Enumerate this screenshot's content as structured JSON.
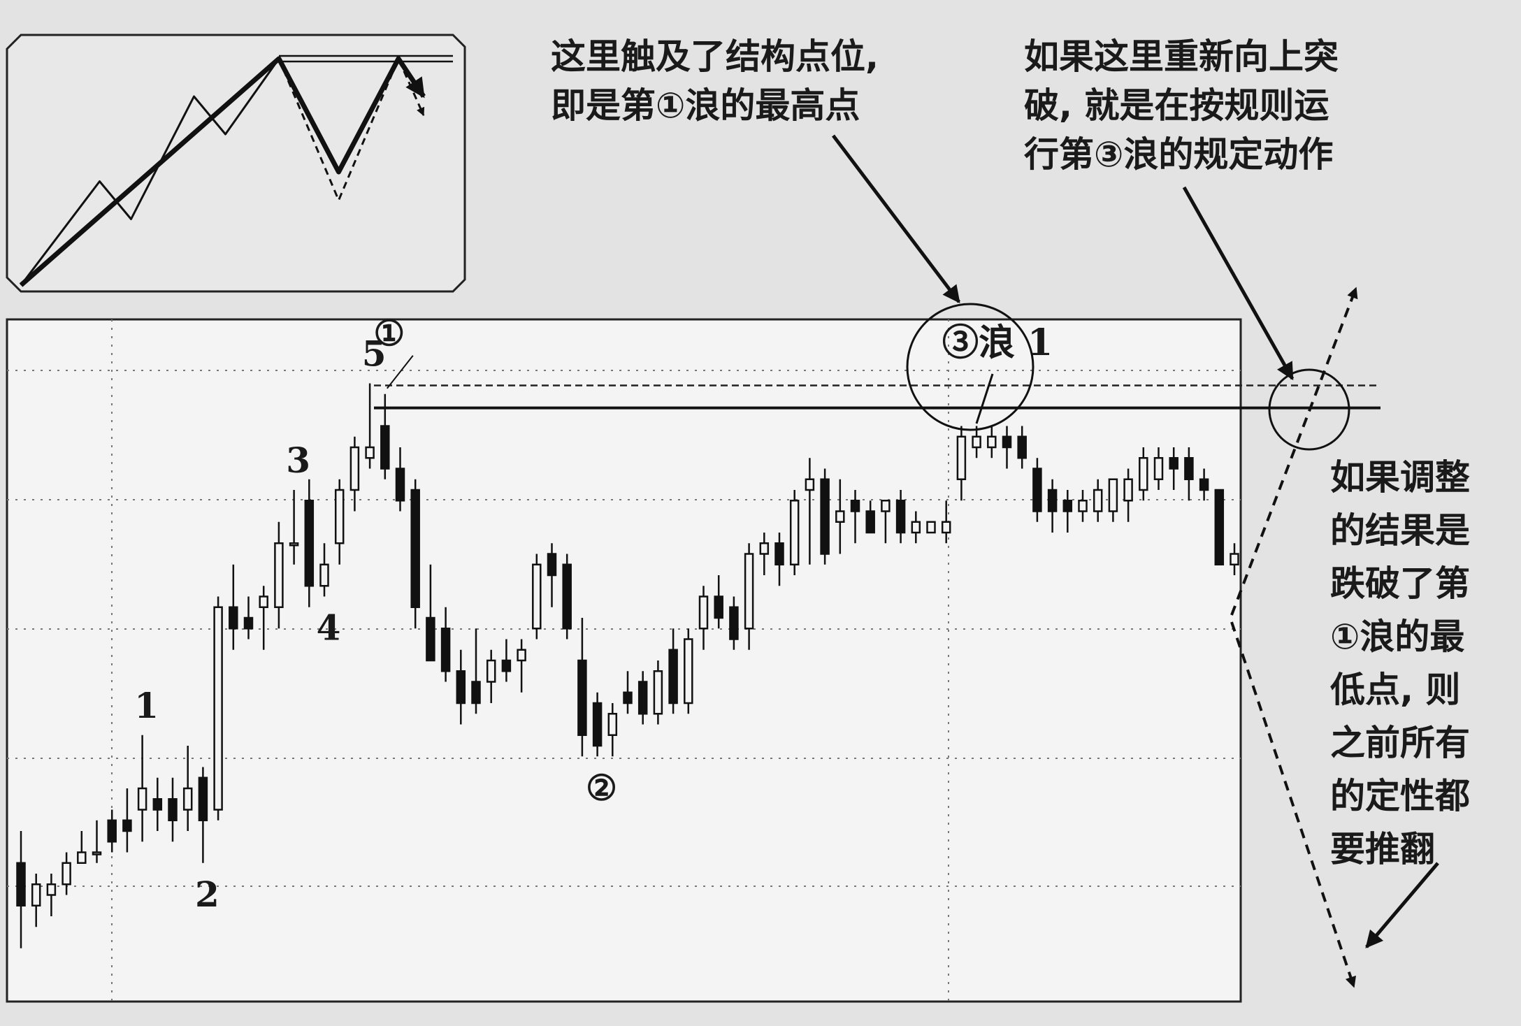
{
  "annotations": {
    "top_left": [
      "这里触及了结构点位,",
      "即是第①浪的最高点"
    ],
    "top_right": [
      "如果这里重新向上突",
      "破, 就是在按规则运",
      "行第③浪的规定动作"
    ],
    "right_side": [
      "如果调整",
      "的结果是",
      "跌破了第",
      "①浪的最",
      "低点, 则",
      "之前所有",
      "的定性都",
      "要推翻"
    ]
  },
  "chart_data": {
    "type": "candlestick",
    "title": "",
    "xlabel": "",
    "ylabel": "",
    "grid": true,
    "wave_labels": [
      {
        "text": "1",
        "bar": 8
      },
      {
        "text": "2",
        "bar": 12
      },
      {
        "text": "3",
        "bar": 18
      },
      {
        "text": "4",
        "bar": 20
      },
      {
        "text": "5",
        "bar": 23
      },
      {
        "text": "①",
        "bar": 24
      },
      {
        "text": "②",
        "bar": 38
      },
      {
        "text": "③浪 1",
        "bar": 63
      }
    ],
    "levels": [
      {
        "name": "wave1-high",
        "style": "dashed",
        "value": 104.8
      },
      {
        "name": "structure-line",
        "style": "solid",
        "value": 102.7
      }
    ],
    "candles": [
      {
        "o": 60,
        "h": 63,
        "l": 52,
        "c": 56
      },
      {
        "o": 56,
        "h": 59,
        "l": 54,
        "c": 58
      },
      {
        "o": 57,
        "h": 59,
        "l": 55,
        "c": 58
      },
      {
        "o": 58,
        "h": 61,
        "l": 57,
        "c": 60
      },
      {
        "o": 60,
        "h": 63,
        "l": 60,
        "c": 61
      },
      {
        "o": 61,
        "h": 64,
        "l": 60,
        "c": 61
      },
      {
        "o": 64,
        "h": 65,
        "l": 61,
        "c": 62
      },
      {
        "o": 64,
        "h": 67,
        "l": 61,
        "c": 63
      },
      {
        "o": 65,
        "h": 72,
        "l": 62,
        "c": 67
      },
      {
        "o": 66,
        "h": 68,
        "l": 63,
        "c": 65
      },
      {
        "o": 66,
        "h": 68,
        "l": 62,
        "c": 64
      },
      {
        "o": 65,
        "h": 71,
        "l": 63,
        "c": 67
      },
      {
        "o": 68,
        "h": 69,
        "l": 60,
        "c": 64
      },
      {
        "o": 65,
        "h": 85,
        "l": 64,
        "c": 84
      },
      {
        "o": 84,
        "h": 88,
        "l": 80,
        "c": 82
      },
      {
        "o": 83,
        "h": 85,
        "l": 81,
        "c": 82
      },
      {
        "o": 84,
        "h": 86,
        "l": 80,
        "c": 85
      },
      {
        "o": 84,
        "h": 92,
        "l": 82,
        "c": 90
      },
      {
        "o": 90,
        "h": 95,
        "l": 88,
        "c": 90
      },
      {
        "o": 94,
        "h": 96,
        "l": 84,
        "c": 86
      },
      {
        "o": 86,
        "h": 90,
        "l": 85,
        "c": 88
      },
      {
        "o": 90,
        "h": 96,
        "l": 88,
        "c": 95
      },
      {
        "o": 95,
        "h": 100,
        "l": 93,
        "c": 99
      },
      {
        "o": 98,
        "h": 105,
        "l": 97,
        "c": 99
      },
      {
        "o": 101,
        "h": 104,
        "l": 96,
        "c": 97
      },
      {
        "o": 97,
        "h": 99,
        "l": 93,
        "c": 94
      },
      {
        "o": 95,
        "h": 96,
        "l": 82,
        "c": 84
      },
      {
        "o": 83,
        "h": 88,
        "l": 80,
        "c": 79
      },
      {
        "o": 82,
        "h": 84,
        "l": 77,
        "c": 78
      },
      {
        "o": 78,
        "h": 80,
        "l": 73,
        "c": 75
      },
      {
        "o": 77,
        "h": 82,
        "l": 74,
        "c": 75
      },
      {
        "o": 77,
        "h": 80,
        "l": 75,
        "c": 79
      },
      {
        "o": 79,
        "h": 81,
        "l": 77,
        "c": 78
      },
      {
        "o": 79,
        "h": 81,
        "l": 76,
        "c": 80
      },
      {
        "o": 82,
        "h": 89,
        "l": 81,
        "c": 88
      },
      {
        "o": 89,
        "h": 90,
        "l": 84,
        "c": 87
      },
      {
        "o": 88,
        "h": 89,
        "l": 81,
        "c": 82
      },
      {
        "o": 79,
        "h": 83,
        "l": 70,
        "c": 72
      },
      {
        "o": 75,
        "h": 76,
        "l": 70,
        "c": 71
      },
      {
        "o": 72,
        "h": 75,
        "l": 70,
        "c": 74
      },
      {
        "o": 76,
        "h": 78,
        "l": 74,
        "c": 75
      },
      {
        "o": 77,
        "h": 78,
        "l": 73,
        "c": 74
      },
      {
        "o": 74,
        "h": 79,
        "l": 73,
        "c": 78
      },
      {
        "o": 80,
        "h": 82,
        "l": 74,
        "c": 75
      },
      {
        "o": 75,
        "h": 82,
        "l": 74,
        "c": 81
      },
      {
        "o": 82,
        "h": 86,
        "l": 80,
        "c": 85
      },
      {
        "o": 85,
        "h": 87,
        "l": 82,
        "c": 83
      },
      {
        "o": 84,
        "h": 85,
        "l": 80,
        "c": 81
      },
      {
        "o": 82,
        "h": 90,
        "l": 80,
        "c": 89
      },
      {
        "o": 89,
        "h": 91,
        "l": 87,
        "c": 90
      },
      {
        "o": 90,
        "h": 91,
        "l": 86,
        "c": 88
      },
      {
        "o": 88,
        "h": 95,
        "l": 87,
        "c": 94
      },
      {
        "o": 95,
        "h": 98,
        "l": 88,
        "c": 96
      },
      {
        "o": 96,
        "h": 97,
        "l": 88,
        "c": 89
      },
      {
        "o": 92,
        "h": 96,
        "l": 89,
        "c": 93
      },
      {
        "o": 94,
        "h": 95,
        "l": 90,
        "c": 93
      },
      {
        "o": 93,
        "h": 94,
        "l": 91,
        "c": 91
      },
      {
        "o": 93,
        "h": 94,
        "l": 90,
        "c": 94
      },
      {
        "o": 94,
        "h": 95,
        "l": 90,
        "c": 91
      },
      {
        "o": 91,
        "h": 93,
        "l": 90,
        "c": 92
      },
      {
        "o": 91,
        "h": 92,
        "l": 91,
        "c": 92
      },
      {
        "o": 91,
        "h": 94,
        "l": 90,
        "c": 92
      },
      {
        "o": 96,
        "h": 101,
        "l": 94,
        "c": 100
      },
      {
        "o": 99,
        "h": 101,
        "l": 98,
        "c": 100
      },
      {
        "o": 99,
        "h": 101,
        "l": 98,
        "c": 100
      },
      {
        "o": 100,
        "h": 101,
        "l": 97,
        "c": 99
      },
      {
        "o": 100,
        "h": 101,
        "l": 97,
        "c": 98
      },
      {
        "o": 97,
        "h": 98,
        "l": 92,
        "c": 93
      },
      {
        "o": 95,
        "h": 96,
        "l": 91,
        "c": 93
      },
      {
        "o": 94,
        "h": 95,
        "l": 91,
        "c": 93
      },
      {
        "o": 93,
        "h": 95,
        "l": 92,
        "c": 94
      },
      {
        "o": 93,
        "h": 96,
        "l": 92,
        "c": 95
      },
      {
        "o": 93,
        "h": 96,
        "l": 92,
        "c": 96
      },
      {
        "o": 94,
        "h": 97,
        "l": 92,
        "c": 96
      },
      {
        "o": 95,
        "h": 99,
        "l": 94,
        "c": 98
      },
      {
        "o": 96,
        "h": 99,
        "l": 95,
        "c": 98
      },
      {
        "o": 98,
        "h": 99,
        "l": 95,
        "c": 97
      },
      {
        "o": 98,
        "h": 99,
        "l": 94,
        "c": 96
      },
      {
        "o": 96,
        "h": 97,
        "l": 94,
        "c": 95
      },
      {
        "o": 95,
        "h": 95,
        "l": 88,
        "c": 88
      },
      {
        "o": 88,
        "h": 90,
        "l": 87,
        "c": 89
      }
    ]
  },
  "inset": {
    "type": "line",
    "series": [
      {
        "style": "thin",
        "values": [
          [
            0,
            0
          ],
          [
            25,
            55
          ],
          [
            35,
            35
          ],
          [
            55,
            100
          ],
          [
            65,
            80
          ],
          [
            82,
            120
          ],
          [
            101,
            60
          ],
          [
            120,
            120
          ],
          [
            128,
            100
          ]
        ]
      },
      {
        "style": "thick",
        "values": [
          [
            0,
            0
          ],
          [
            82,
            120
          ],
          [
            101,
            60
          ],
          [
            120,
            120
          ],
          [
            128,
            100
          ]
        ]
      },
      {
        "style": "dashed",
        "values": [
          [
            82,
            120
          ],
          [
            101,
            45
          ],
          [
            120,
            120
          ],
          [
            128,
            90
          ]
        ]
      }
    ],
    "levels": [
      {
        "value": 120,
        "style": "double"
      }
    ]
  }
}
